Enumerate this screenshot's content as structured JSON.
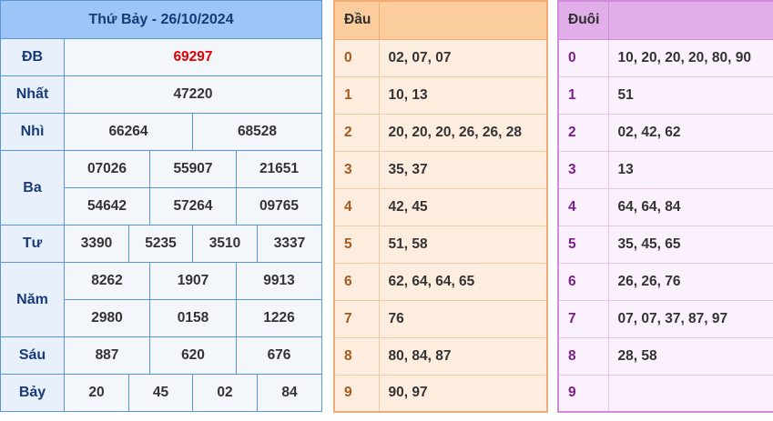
{
  "header": {
    "date_title": "Thứ Bảy - 26/10/2024"
  },
  "prizes": {
    "db": {
      "label": "ĐB",
      "values": [
        "69297"
      ]
    },
    "nhat": {
      "label": "Nhất",
      "values": [
        "47220"
      ]
    },
    "nhi": {
      "label": "Nhì",
      "values": [
        "66264",
        "68528"
      ]
    },
    "ba": {
      "label": "Ba",
      "values": [
        "07026",
        "55907",
        "21651",
        "54642",
        "57264",
        "09765"
      ]
    },
    "tu": {
      "label": "Tư",
      "values": [
        "3390",
        "5235",
        "3510",
        "3337"
      ]
    },
    "nam": {
      "label": "Năm",
      "values": [
        "8262",
        "1907",
        "9913",
        "2980",
        "0158",
        "1226"
      ]
    },
    "sau": {
      "label": "Sáu",
      "values": [
        "887",
        "620",
        "676"
      ]
    },
    "bay": {
      "label": "Bảy",
      "values": [
        "20",
        "45",
        "02",
        "84"
      ]
    }
  },
  "dau": {
    "title": "Đầu",
    "rows": [
      {
        "key": "0",
        "values": "02, 07, 07"
      },
      {
        "key": "1",
        "values": "10, 13"
      },
      {
        "key": "2",
        "values": "20, 20, 20, 26, 26, 28"
      },
      {
        "key": "3",
        "values": "35, 37"
      },
      {
        "key": "4",
        "values": "42, 45"
      },
      {
        "key": "5",
        "values": "51, 58"
      },
      {
        "key": "6",
        "values": "62, 64, 64, 65"
      },
      {
        "key": "7",
        "values": "76"
      },
      {
        "key": "8",
        "values": "80, 84, 87"
      },
      {
        "key": "9",
        "values": "90, 97"
      }
    ]
  },
  "duoi": {
    "title": "Đuôi",
    "rows": [
      {
        "key": "0",
        "values": "10, 20, 20, 20, 80, 90"
      },
      {
        "key": "1",
        "values": "51"
      },
      {
        "key": "2",
        "values": "02, 42, 62"
      },
      {
        "key": "3",
        "values": "13"
      },
      {
        "key": "4",
        "values": "64, 64, 84"
      },
      {
        "key": "5",
        "values": "35, 45, 65"
      },
      {
        "key": "6",
        "values": "26, 26, 76"
      },
      {
        "key": "7",
        "values": "07, 07, 37, 87, 97"
      },
      {
        "key": "8",
        "values": "28, 58"
      },
      {
        "key": "9",
        "values": ""
      }
    ]
  },
  "colors": {
    "special_prize": "#e00000",
    "results_header_bg": "#9ec5f7",
    "dau_header_bg": "#fbcd9c",
    "duoi_header_bg": "#e2aeea"
  }
}
